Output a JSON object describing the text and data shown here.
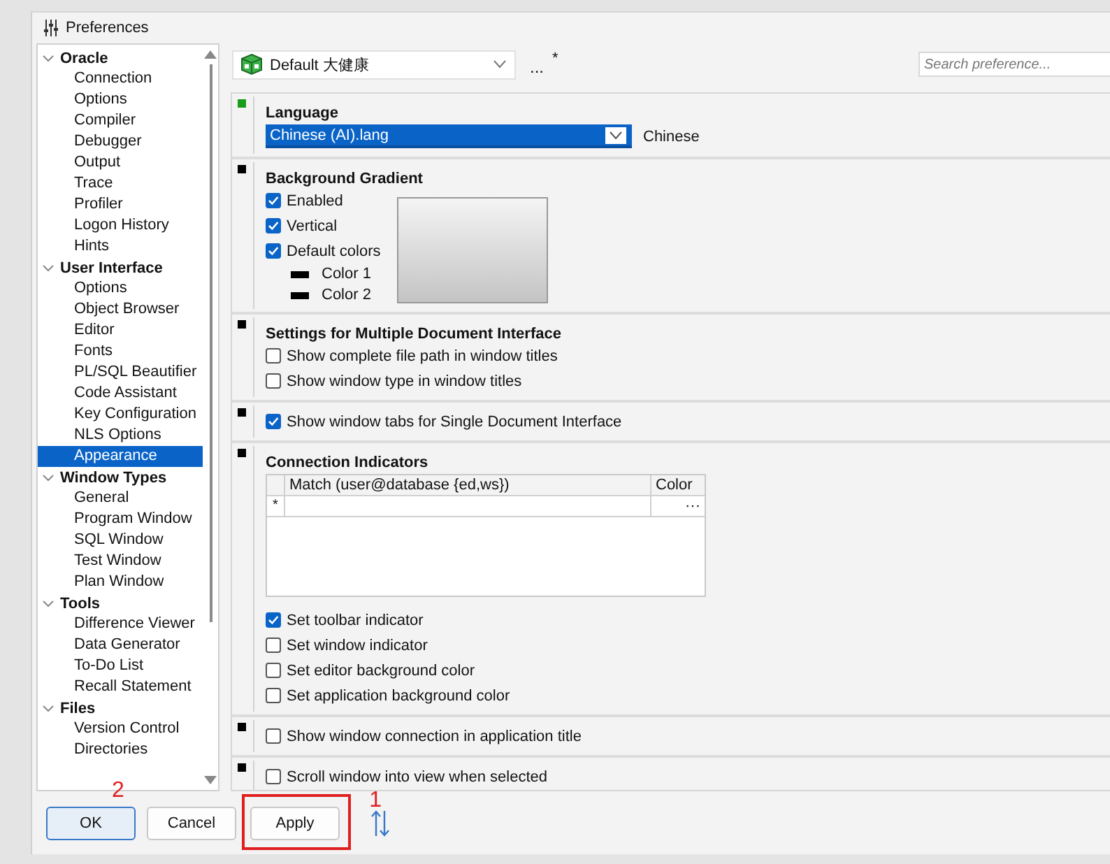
{
  "window": {
    "title": "Preferences"
  },
  "sidebar": {
    "groups": [
      {
        "label": "Oracle",
        "expanded": true,
        "children": [
          {
            "label": "Connection",
            "selected": false
          },
          {
            "label": "Options",
            "selected": false
          },
          {
            "label": "Compiler",
            "selected": false
          },
          {
            "label": "Debugger",
            "selected": false
          },
          {
            "label": "Output",
            "selected": false
          },
          {
            "label": "Trace",
            "selected": false
          },
          {
            "label": "Profiler",
            "selected": false
          },
          {
            "label": "Logon History",
            "selected": false
          },
          {
            "label": "Hints",
            "selected": false
          }
        ]
      },
      {
        "label": "User Interface",
        "expanded": true,
        "children": [
          {
            "label": "Options",
            "selected": false
          },
          {
            "label": "Object Browser",
            "selected": false
          },
          {
            "label": "Editor",
            "selected": false
          },
          {
            "label": "Fonts",
            "selected": false
          },
          {
            "label": "PL/SQL Beautifier",
            "selected": false
          },
          {
            "label": "Code Assistant",
            "selected": false
          },
          {
            "label": "Key Configuration",
            "selected": false
          },
          {
            "label": "NLS Options",
            "selected": false
          },
          {
            "label": "Appearance",
            "selected": true
          }
        ]
      },
      {
        "label": "Window Types",
        "expanded": true,
        "children": [
          {
            "label": "General",
            "selected": false
          },
          {
            "label": "Program Window",
            "selected": false
          },
          {
            "label": "SQL Window",
            "selected": false
          },
          {
            "label": "Test Window",
            "selected": false
          },
          {
            "label": "Plan Window",
            "selected": false
          }
        ]
      },
      {
        "label": "Tools",
        "expanded": true,
        "children": [
          {
            "label": "Difference Viewer",
            "selected": false
          },
          {
            "label": "Data Generator",
            "selected": false
          },
          {
            "label": "To-Do List",
            "selected": false
          },
          {
            "label": "Recall Statement",
            "selected": false
          }
        ]
      },
      {
        "label": "Files",
        "expanded": true,
        "children": [
          {
            "label": "Version Control",
            "selected": false
          },
          {
            "label": "Directories",
            "selected": false
          }
        ]
      }
    ]
  },
  "profile": {
    "value": "Default 大健康",
    "more": "...",
    "modified": "*"
  },
  "search": {
    "placeholder": "Search preference..."
  },
  "sections": [
    {
      "color": "#1a9e1a",
      "title": "Language",
      "items": [
        {
          "kind": "dropdown",
          "value": "Chinese (AI).lang",
          "note": "Chinese"
        }
      ]
    },
    {
      "color": "#000000",
      "title": "Background Gradient",
      "preview": true,
      "items": [
        {
          "kind": "checkbox",
          "label": "Enabled",
          "checked": true
        },
        {
          "kind": "checkbox",
          "label": "Vertical",
          "checked": true
        },
        {
          "kind": "checkbox",
          "label": "Default colors",
          "checked": true
        },
        {
          "kind": "swatch",
          "label": "Color 1",
          "color": "#000000"
        },
        {
          "kind": "swatch",
          "label": "Color 2",
          "color": "#000000"
        }
      ]
    },
    {
      "color": "#000000",
      "title": "Settings for Multiple Document Interface",
      "items": [
        {
          "kind": "checkbox",
          "label": "Show complete file path in window titles",
          "checked": false
        },
        {
          "kind": "checkbox",
          "label": "Show window type in window titles",
          "checked": false
        }
      ]
    },
    {
      "color": "#000000",
      "items": [
        {
          "kind": "checkbox",
          "label": "Show window tabs for Single Document Interface",
          "checked": true
        }
      ]
    },
    {
      "color": "#000000",
      "title": "Connection Indicators",
      "items": [
        {
          "kind": "table",
          "columns": [
            "Match (user@database {ed,ws})",
            "Color"
          ],
          "rows": [
            {
              "marker": "*",
              "cells": [
                "",
                "···"
              ]
            }
          ]
        },
        {
          "kind": "checkbox",
          "label": "Set toolbar indicator",
          "checked": true
        },
        {
          "kind": "checkbox",
          "label": "Set window indicator",
          "checked": false
        },
        {
          "kind": "checkbox",
          "label": "Set editor background color",
          "checked": false
        },
        {
          "kind": "checkbox",
          "label": "Set application background color",
          "checked": false
        }
      ]
    },
    {
      "color": "#000000",
      "items": [
        {
          "kind": "checkbox",
          "label": "Show window connection in application title",
          "checked": false
        }
      ]
    },
    {
      "color": "#000000",
      "items": [
        {
          "kind": "checkbox",
          "label": "Scroll window into view when selected",
          "checked": false
        }
      ]
    }
  ],
  "buttons": [
    {
      "label": "OK",
      "default": true,
      "highlighted": false,
      "note": "2"
    },
    {
      "label": "Cancel",
      "default": false,
      "highlighted": false
    },
    {
      "label": "Apply",
      "default": false,
      "highlighted": true,
      "note": "1"
    }
  ]
}
